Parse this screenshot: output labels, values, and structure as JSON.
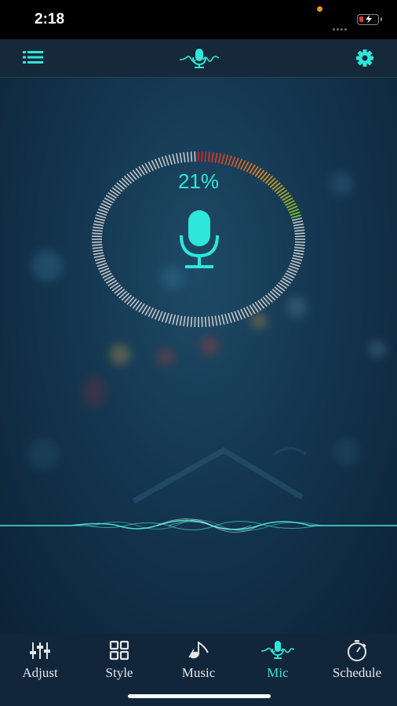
{
  "status_bar": {
    "time": "2:18",
    "battery_level": "low"
  },
  "header": {
    "menu_icon": "list-icon",
    "logo_icon": "mic-wave-icon",
    "settings_icon": "gear-icon"
  },
  "meter": {
    "percent_label": "21%",
    "level": 0.21,
    "colors": {
      "accent": "#2ee6da",
      "track": "#c8c8c8",
      "level_start": "#e02020",
      "level_end": "#7ed321"
    }
  },
  "tabs": [
    {
      "label": "Adjust",
      "icon": "sliders-icon",
      "active": false
    },
    {
      "label": "Style",
      "icon": "grid-icon",
      "active": false
    },
    {
      "label": "Music",
      "icon": "music-note-icon",
      "active": false
    },
    {
      "label": "Mic",
      "icon": "mic-wave-icon",
      "active": true
    },
    {
      "label": "Schedule",
      "icon": "timer-icon",
      "active": false
    }
  ]
}
